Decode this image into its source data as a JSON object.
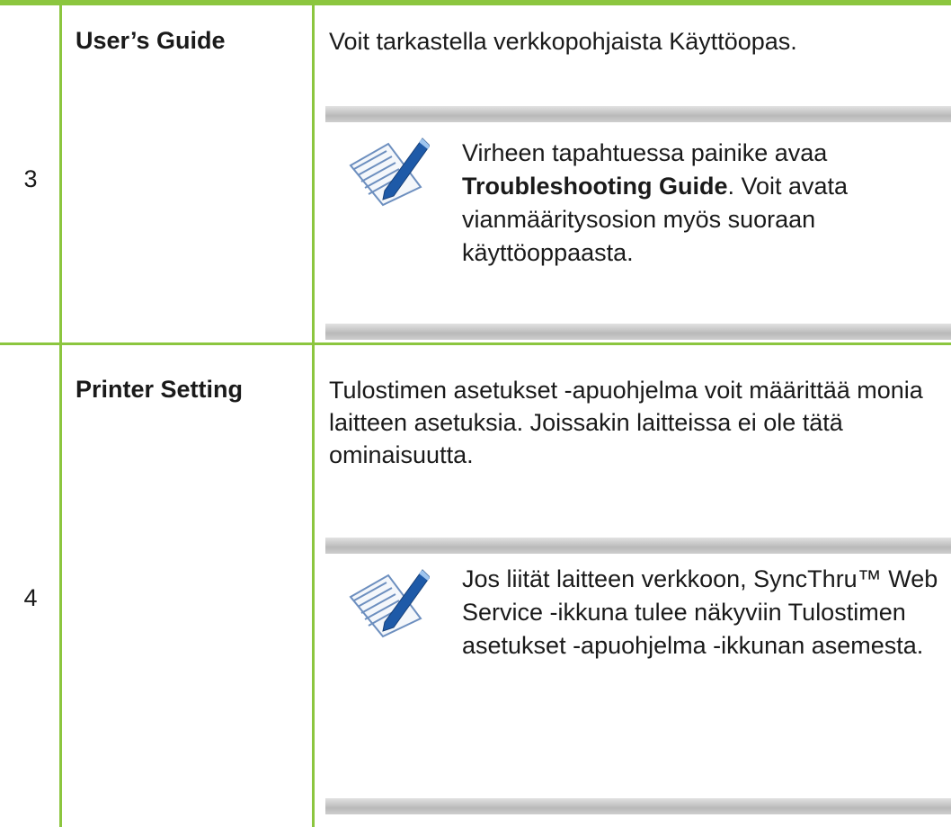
{
  "colors": {
    "border": "#8cc63f",
    "note_bar": "#c4c4c4"
  },
  "rows": [
    {
      "number": "3",
      "name": "User’s Guide",
      "description": "Voit tarkastella verkkopohjaista Käyttöopas.",
      "note": {
        "icon": "note-pencil-icon",
        "text_before": "Virheen tapahtuessa painike avaa ",
        "bold": "Troubleshooting Guide",
        "text_after": ". Voit avata vianmääritysosion myös suoraan käyttöoppaasta."
      }
    },
    {
      "number": "4",
      "name": "Printer Setting",
      "description": "Tulostimen asetukset -apuohjelma voit määrittää monia laitteen asetuksia. Joissakin laitteissa ei ole tätä ominaisuutta.",
      "note": {
        "icon": "note-pencil-icon",
        "text": "Jos liität laitteen verkkoon, SyncThru™ Web Service -ikkuna tulee näkyviin Tulostimen asetukset -apuohjelma -ikkunan asemesta."
      }
    }
  ]
}
